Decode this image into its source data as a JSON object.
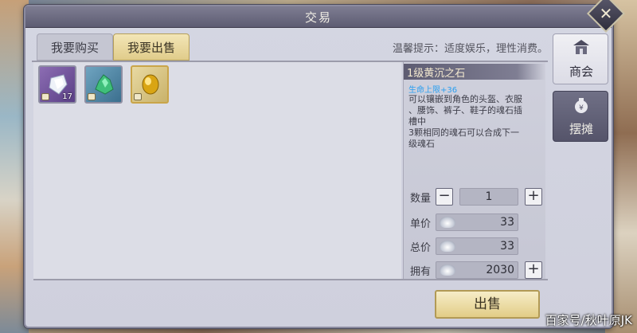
{
  "window": {
    "title": "交易",
    "close_icon": "close-icon"
  },
  "tabs": [
    {
      "label": "我要购买",
      "active": false
    },
    {
      "label": "我要出售",
      "active": true
    }
  ],
  "tip": "温馨提示：适度娱乐，理性消费。",
  "inventory": {
    "items": [
      {
        "icon": "white-crystal-icon",
        "count": "17",
        "locked": true
      },
      {
        "icon": "green-crystal-icon",
        "count": "",
        "locked": true
      },
      {
        "icon": "yellow-soulstone-icon",
        "count": "",
        "locked": true,
        "selected": true
      }
    ]
  },
  "item_detail": {
    "name": "1级黄沉之石",
    "subtitle": "生命上限+36",
    "description": "可以镶嵌到角色的头盔、衣服\n、腰饰、裤子、鞋子的魂石插\n槽中\n3颗相同的魂石可以合成下一\n级魂石"
  },
  "trade": {
    "quantity_label": "数量",
    "quantity": "1",
    "unit_price_label": "单价",
    "unit_price": "33",
    "total_label": "总价",
    "total": "33",
    "owned_label": "拥有",
    "owned": "2030",
    "minus_symbol": "−",
    "plus_symbol": "+"
  },
  "side_tabs": [
    {
      "label": "商会",
      "icon": "merchant-guild-icon",
      "active": true
    },
    {
      "label": "摆摊",
      "icon": "stall-bag-icon",
      "active": false
    }
  ],
  "sell_button": "出售",
  "watermark": "百家号/秋叶原JK",
  "colors": {
    "accent_gold": "#e0cc8a",
    "panel": "#d4d6e2",
    "title_bar": "#5d5c72",
    "subtitle_blue": "#2a9ff0"
  }
}
